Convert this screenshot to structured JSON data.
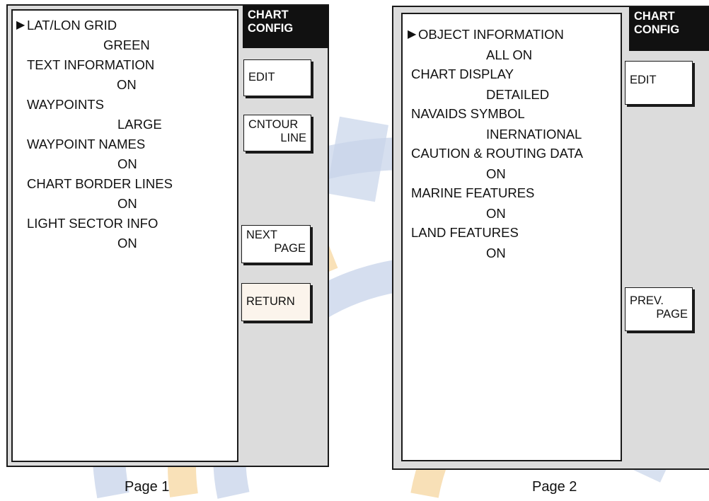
{
  "pages": [
    {
      "caption": "Page 1",
      "title": [
        "CHART",
        "CONFIG"
      ],
      "items": [
        {
          "label": "LAT/LON GRID",
          "value": "GREEN",
          "selected": true
        },
        {
          "label": "TEXT INFORMATION",
          "value": "ON"
        },
        {
          "label": "WAYPOINTS",
          "value": "LARGE"
        },
        {
          "label": "WAYPOINT NAMES",
          "value": "ON"
        },
        {
          "label": "CHART BORDER LINES",
          "value": "ON"
        },
        {
          "label": "LIGHT SECTOR INFO",
          "value": "ON"
        }
      ],
      "softkeys": {
        "edit": [
          "EDIT"
        ],
        "contour": [
          "CNTOUR",
          "LINE"
        ],
        "next_page": [
          "NEXT",
          "PAGE"
        ],
        "return": [
          "RETURN"
        ]
      }
    },
    {
      "caption": "Page 2",
      "title": [
        "CHART",
        "CONFIG"
      ],
      "items": [
        {
          "label": "OBJECT INFORMATION",
          "value": "ALL ON",
          "selected": true
        },
        {
          "label": "CHART DISPLAY",
          "value": "DETAILED"
        },
        {
          "label": "NAVAIDS SYMBOL",
          "value": "INERNATIONAL"
        },
        {
          "label": "CAUTION & ROUTING DATA",
          "value": "ON"
        },
        {
          "label": "MARINE FEATURES",
          "value": "ON"
        },
        {
          "label": "LAND FEATURES",
          "value": "ON"
        }
      ],
      "softkeys": {
        "edit": [
          "EDIT"
        ],
        "prev_page": [
          "PREV.",
          "PAGE"
        ]
      }
    }
  ],
  "cursor_glyph": "▶",
  "colors": {
    "screen_bg": "#dcdcdc",
    "title_bg": "#111111",
    "title_text": "#ffffff",
    "watermark_blue": "#c8d4ea",
    "watermark_orange": "#f7d9a6"
  }
}
